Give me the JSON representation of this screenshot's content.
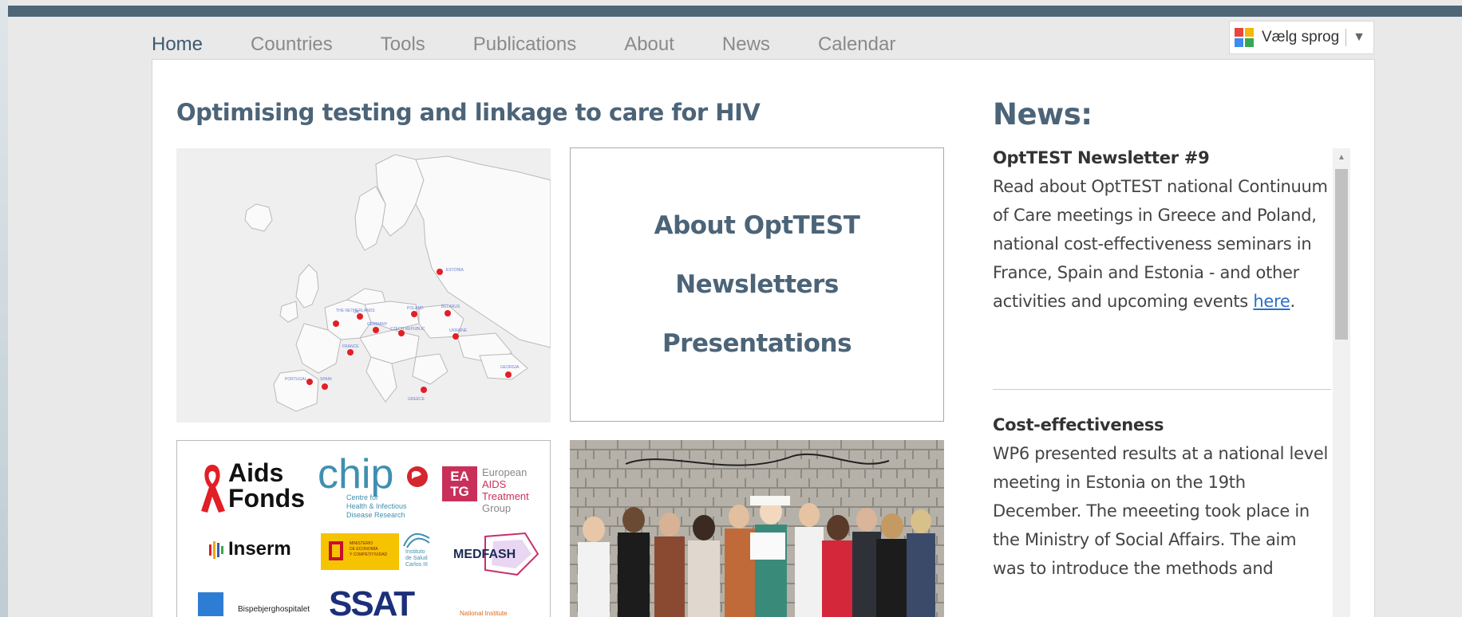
{
  "nav": {
    "items": [
      {
        "label": "Home",
        "active": true
      },
      {
        "label": "Countries",
        "active": false
      },
      {
        "label": "Tools",
        "active": false
      },
      {
        "label": "Publications",
        "active": false
      },
      {
        "label": "About",
        "active": false
      },
      {
        "label": "News",
        "active": false
      },
      {
        "label": "Calendar",
        "active": false
      }
    ]
  },
  "language": {
    "label": "Vælg sprog",
    "arrow": "▼",
    "icon": "google-translate-icon"
  },
  "main": {
    "headline": "Optimising testing and linkage to care for HIV",
    "map": {
      "labels": [
        "ESTONIA",
        "THE NETHERLANDS",
        "UK",
        "GERMANY",
        "POLAND",
        "BELARUS",
        "CZECH REPUBLIC",
        "UKRAINE",
        "FRANCE",
        "PORTUGAL",
        "SPAIN",
        "GREECE",
        "GEORGIA"
      ]
    },
    "about_links": [
      "About OptTEST",
      "Newsletters",
      "Presentations"
    ],
    "partners": {
      "aids_fonds": [
        "Aids",
        "Fonds"
      ],
      "chip": {
        "name": "chip",
        "sub": [
          "Centre for",
          "Health & Infectious",
          "Disease Research"
        ]
      },
      "eatg": {
        "badge": [
          "EA",
          "TG"
        ],
        "text": [
          "European",
          "AIDS Treatment",
          "Group"
        ]
      },
      "inserm": "Inserm",
      "ministerio": [
        "MINISTERIO",
        "DE ECONOMÍA",
        "Y COMPETITIVIDAD"
      ],
      "isc": [
        "Instituto",
        "de Salud",
        "Carlos III"
      ],
      "medfash": "MEDFASH",
      "bispebjerg": "Bispebjerghospitalet",
      "ssat": "SSAT",
      "national": "National Institute"
    }
  },
  "news": {
    "title": "News:",
    "items": [
      {
        "heading": "OptTEST Newsletter #9",
        "body": "Read about OptTEST national Continuum of Care meetings in Greece and Poland, national cost-effectiveness seminars in France, Spain and Estonia - and other activities and upcoming events ",
        "link": "here",
        "after": "."
      },
      {
        "heading": "Cost-effectiveness",
        "body": "WP6 presented results at a national level meeting in Estonia on the 19th December. The meeeting  took place in the Ministry of Social Affairs. The aim was to introduce the methods and"
      }
    ]
  },
  "colors": {
    "accent": "#4c6478",
    "topbar": "#4f6677",
    "link": "#2a6fc9",
    "map_dot": "#e21e26"
  }
}
